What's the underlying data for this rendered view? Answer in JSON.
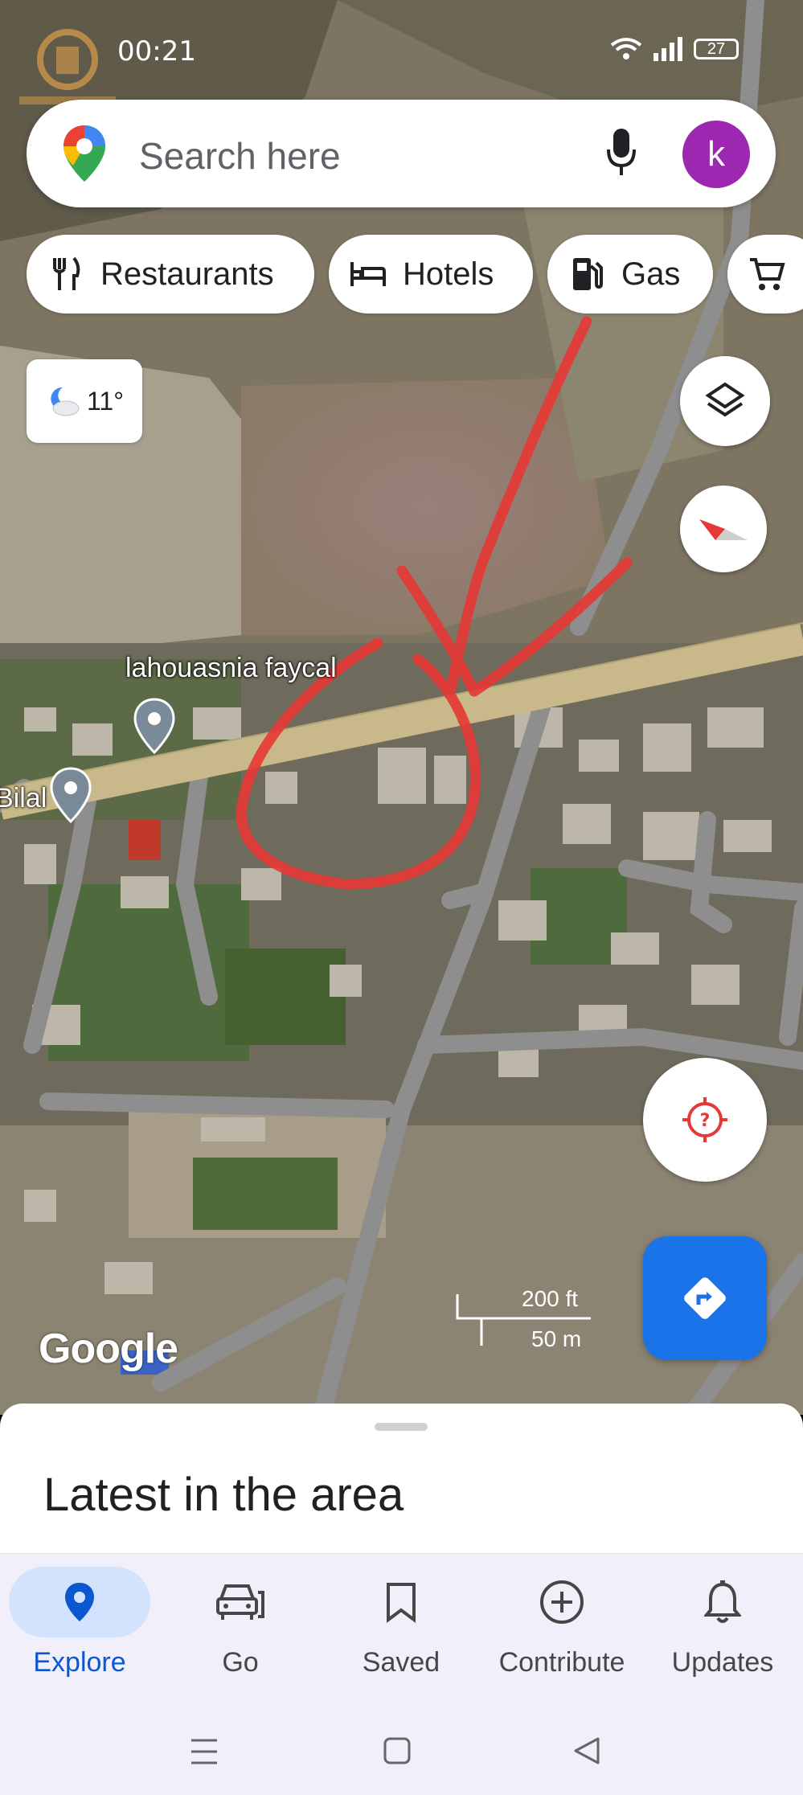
{
  "status_bar": {
    "time": "00:21",
    "battery": "27"
  },
  "search": {
    "placeholder": "Search here",
    "avatar_letter": "k"
  },
  "chips": [
    {
      "label": "Restaurants",
      "icon": "fork-knife-icon"
    },
    {
      "label": "Hotels",
      "icon": "bed-icon"
    },
    {
      "label": "Gas",
      "icon": "gas-pump-icon"
    },
    {
      "label": "",
      "icon": "cart-icon"
    }
  ],
  "weather": {
    "temp": "11°",
    "icon": "partly-cloudy-night-icon"
  },
  "map": {
    "places": [
      "lahouasnia faycal",
      "Bilal"
    ],
    "scale_imperial": "200 ft",
    "scale_metric": "50 m",
    "logo": "Google",
    "accent_road": "#c9b98a",
    "annotation_color": "#e53935"
  },
  "sheet": {
    "title": "Latest in the area"
  },
  "bottom_nav": [
    {
      "label": "Explore",
      "icon": "explore-pin-icon",
      "active": true
    },
    {
      "label": "Go",
      "icon": "car-icon",
      "active": false
    },
    {
      "label": "Saved",
      "icon": "bookmark-icon",
      "active": false
    },
    {
      "label": "Contribute",
      "icon": "add-circle-icon",
      "active": false
    },
    {
      "label": "Updates",
      "icon": "bell-icon",
      "active": false
    }
  ],
  "colors": {
    "primary": "#1a73e8",
    "avatar": "#9c27b0",
    "nav_active": "#0b57d0"
  }
}
